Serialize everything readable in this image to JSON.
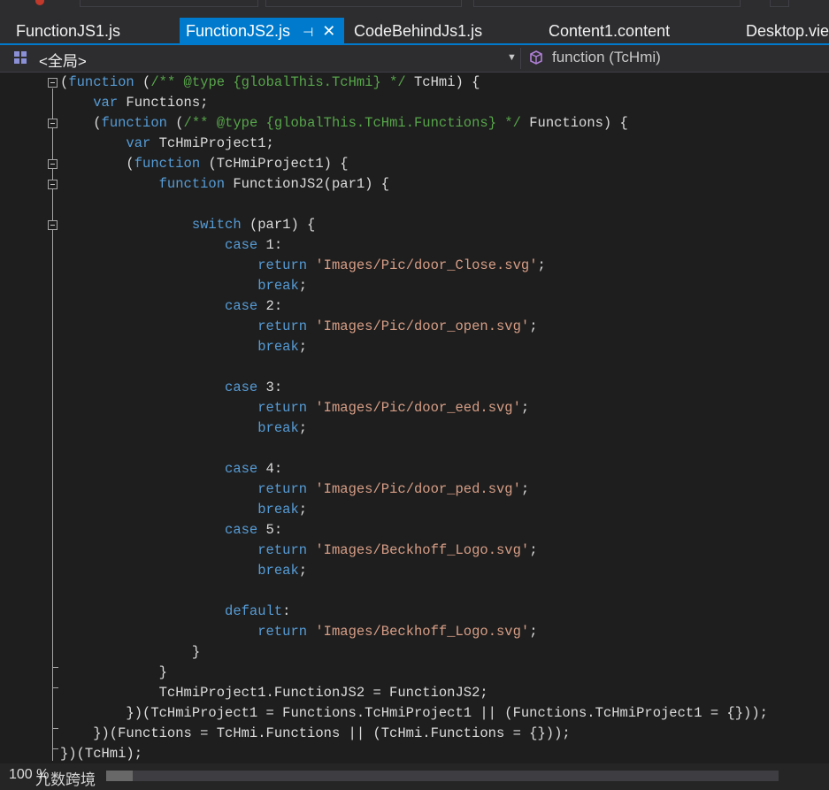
{
  "tabs": [
    {
      "label": "FunctionJS1.js",
      "active": false
    },
    {
      "label": "FunctionJS2.js",
      "active": true,
      "pin_icon": "pin-icon",
      "close_icon": "close-icon"
    },
    {
      "label": "CodeBehindJs1.js",
      "active": false
    },
    {
      "label": "Content1.content",
      "active": false
    },
    {
      "label": "Desktop.vie",
      "active": false
    }
  ],
  "tab_icons": {
    "pin": "⊣",
    "close": "✕"
  },
  "navbar": {
    "scope_label": "<全局>",
    "scope_icon": "grid-icon",
    "member_label": "function (TcHmi)",
    "member_icon": "cube-icon",
    "dropdown_glyph": "▼"
  },
  "colors": {
    "accent": "#007acc",
    "background": "#1e1e1e",
    "keyword": "#569cd6",
    "string": "#d69d85",
    "comment": "#57a64a",
    "text": "#dcdcdc"
  },
  "code_lines": [
    [
      [
        "p",
        "("
      ],
      [
        "k",
        "function"
      ],
      [
        "p",
        " ("
      ],
      [
        "c",
        "/** @type {globalThis.TcHmi} */"
      ],
      [
        "p",
        " TcHmi) {"
      ]
    ],
    [
      [
        "p",
        "    "
      ],
      [
        "k",
        "var"
      ],
      [
        "p",
        " Functions;"
      ]
    ],
    [
      [
        "p",
        "    ("
      ],
      [
        "k",
        "function"
      ],
      [
        "p",
        " ("
      ],
      [
        "c",
        "/** @type {globalThis.TcHmi.Functions} */"
      ],
      [
        "p",
        " Functions) {"
      ]
    ],
    [
      [
        "p",
        "        "
      ],
      [
        "k",
        "var"
      ],
      [
        "p",
        " TcHmiProject1;"
      ]
    ],
    [
      [
        "p",
        "        ("
      ],
      [
        "k",
        "function"
      ],
      [
        "p",
        " (TcHmiProject1) {"
      ]
    ],
    [
      [
        "p",
        "            "
      ],
      [
        "k",
        "function"
      ],
      [
        "p",
        " FunctionJS2(par1) {"
      ]
    ],
    [
      [
        "p",
        ""
      ]
    ],
    [
      [
        "p",
        "                "
      ],
      [
        "k",
        "switch"
      ],
      [
        "p",
        " (par1) {"
      ]
    ],
    [
      [
        "p",
        "                    "
      ],
      [
        "k",
        "case"
      ],
      [
        "p",
        " 1:"
      ]
    ],
    [
      [
        "p",
        "                        "
      ],
      [
        "k",
        "return"
      ],
      [
        "p",
        " "
      ],
      [
        "s",
        "'Images/Pic/door_Close.svg'"
      ],
      [
        "p",
        ";"
      ]
    ],
    [
      [
        "p",
        "                        "
      ],
      [
        "k",
        "break"
      ],
      [
        "p",
        ";"
      ]
    ],
    [
      [
        "p",
        "                    "
      ],
      [
        "k",
        "case"
      ],
      [
        "p",
        " 2:"
      ]
    ],
    [
      [
        "p",
        "                        "
      ],
      [
        "k",
        "return"
      ],
      [
        "p",
        " "
      ],
      [
        "s",
        "'Images/Pic/door_open.svg'"
      ],
      [
        "p",
        ";"
      ]
    ],
    [
      [
        "p",
        "                        "
      ],
      [
        "k",
        "break"
      ],
      [
        "p",
        ";"
      ]
    ],
    [
      [
        "p",
        ""
      ]
    ],
    [
      [
        "p",
        "                    "
      ],
      [
        "k",
        "case"
      ],
      [
        "p",
        " 3:"
      ]
    ],
    [
      [
        "p",
        "                        "
      ],
      [
        "k",
        "return"
      ],
      [
        "p",
        " "
      ],
      [
        "s",
        "'Images/Pic/door_eed.svg'"
      ],
      [
        "p",
        ";"
      ]
    ],
    [
      [
        "p",
        "                        "
      ],
      [
        "k",
        "break"
      ],
      [
        "p",
        ";"
      ]
    ],
    [
      [
        "p",
        ""
      ]
    ],
    [
      [
        "p",
        "                    "
      ],
      [
        "k",
        "case"
      ],
      [
        "p",
        " 4:"
      ]
    ],
    [
      [
        "p",
        "                        "
      ],
      [
        "k",
        "return"
      ],
      [
        "p",
        " "
      ],
      [
        "s",
        "'Images/Pic/door_ped.svg'"
      ],
      [
        "p",
        ";"
      ]
    ],
    [
      [
        "p",
        "                        "
      ],
      [
        "k",
        "break"
      ],
      [
        "p",
        ";"
      ]
    ],
    [
      [
        "p",
        "                    "
      ],
      [
        "k",
        "case"
      ],
      [
        "p",
        " 5:"
      ]
    ],
    [
      [
        "p",
        "                        "
      ],
      [
        "k",
        "return"
      ],
      [
        "p",
        " "
      ],
      [
        "s",
        "'Images/Beckhoff_Logo.svg'"
      ],
      [
        "p",
        ";"
      ]
    ],
    [
      [
        "p",
        "                        "
      ],
      [
        "k",
        "break"
      ],
      [
        "p",
        ";"
      ]
    ],
    [
      [
        "p",
        ""
      ]
    ],
    [
      [
        "p",
        "                    "
      ],
      [
        "k",
        "default"
      ],
      [
        "p",
        ":"
      ]
    ],
    [
      [
        "p",
        "                        "
      ],
      [
        "k",
        "return"
      ],
      [
        "p",
        " "
      ],
      [
        "s",
        "'Images/Beckhoff_Logo.svg'"
      ],
      [
        "p",
        ";"
      ]
    ],
    [
      [
        "p",
        "                }"
      ]
    ],
    [
      [
        "p",
        "            }"
      ]
    ],
    [
      [
        "p",
        "            TcHmiProject1.FunctionJS2 = FunctionJS2;"
      ]
    ],
    [
      [
        "p",
        "        })(TcHmiProject1 = Functions.TcHmiProject1 || (Functions.TcHmiProject1 = {}));"
      ]
    ],
    [
      [
        "p",
        "    })(Functions = TcHmi.Functions || (TcHmi.Functions = {}));"
      ]
    ],
    [
      [
        "p",
        "})(TcHmi);"
      ]
    ]
  ],
  "status": {
    "zoom": "100 %",
    "watermark": "九数跨境"
  }
}
